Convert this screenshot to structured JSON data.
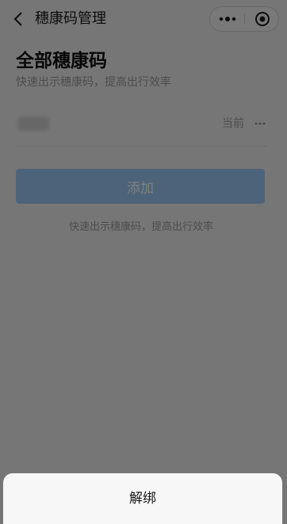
{
  "navbar": {
    "back_icon": "chevron-left-icon",
    "title": "穗康码管理",
    "capsule": {
      "more_icon": "more-dots-icon",
      "close_icon": "target-circle-icon"
    }
  },
  "main": {
    "heading": "全部穗康码",
    "subtitle": "快速出示穗康码，提高出行效率",
    "codes": [
      {
        "status": "当前",
        "more_icon": "more-dots-icon"
      }
    ],
    "add_button": "添加",
    "footer_tip": "快速出示穗康码，提高出行效率"
  },
  "action_sheet": {
    "items": [
      {
        "label": "解绑"
      }
    ]
  },
  "colors": {
    "page_background": "#ededed",
    "add_button": "#9ac6f5",
    "mask": "rgba(0,0,0,0.5)",
    "sheet_background": "#f7f7f7"
  }
}
